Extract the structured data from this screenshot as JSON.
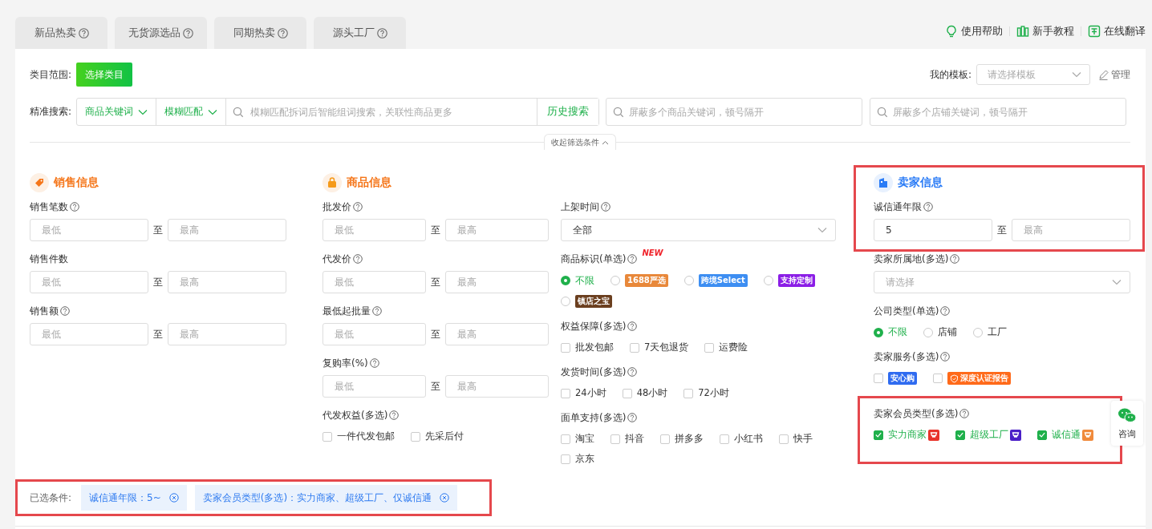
{
  "tabs": [
    {
      "label": "新品热卖",
      "selected": false
    },
    {
      "label": "无货源选品",
      "selected": false
    },
    {
      "label": "同期热卖",
      "selected": false
    },
    {
      "label": "源头工厂",
      "selected": false
    }
  ],
  "help_links": [
    "使用帮助",
    "新手教程",
    "在线翻译"
  ],
  "category": {
    "label": "类目范围:",
    "button": "选择类目"
  },
  "template": {
    "label": "我的模板:",
    "placeholder": "请选择模板",
    "manage": "管理"
  },
  "search": {
    "label": "精准搜索:",
    "dropdowns": [
      "商品关键词",
      "模糊匹配"
    ],
    "placeholder": "模糊匹配拆词后智能组词搜索，关联性商品更多",
    "history": "历史搜索",
    "exclude_placeholders": [
      "屏蔽多个商品关键词，顿号隔开",
      "屏蔽多个店铺关键词，顿号隔开"
    ]
  },
  "collapse": "收起筛选条件",
  "columns": [
    {
      "header": {
        "title": "销售信息",
        "color": "#f5761a",
        "highlighted": false
      },
      "fields": [
        {
          "kind": "range",
          "label": "销售笔数",
          "help": true,
          "min_placeholder": "最低",
          "separator": "至",
          "max_placeholder": "最高",
          "highlighted": false
        },
        {
          "kind": "range",
          "label": "销售件数",
          "help": false,
          "min_placeholder": "最低",
          "separator": "至",
          "max_placeholder": "最高",
          "highlighted": false
        },
        {
          "kind": "range",
          "label": "销售额",
          "help": true,
          "min_placeholder": "最低",
          "separator": "至",
          "max_placeholder": "最高",
          "highlighted": false
        }
      ]
    },
    {
      "header": {
        "title": "商品信息",
        "color": "#f5761a",
        "highlighted": false
      },
      "fields": [
        {
          "kind": "range",
          "label": "批发价",
          "help": true,
          "min_placeholder": "最低",
          "separator": "至",
          "max_placeholder": "最高",
          "highlighted": false
        },
        {
          "kind": "range",
          "label": "代发价",
          "help": true,
          "min_placeholder": "最低",
          "separator": "至",
          "max_placeholder": "最高",
          "highlighted": false
        },
        {
          "kind": "range",
          "label": "最低起批量",
          "help": true,
          "min_placeholder": "最低",
          "separator": "至",
          "max_placeholder": "最高",
          "highlighted": false
        },
        {
          "kind": "range",
          "label": "复购率(%)",
          "help": true,
          "min_placeholder": "最低",
          "separator": "至",
          "max_placeholder": "最高",
          "highlighted": false
        },
        {
          "kind": "checkbox",
          "label": "代发权益(多选)",
          "help": true,
          "highlighted": false,
          "options": [
            {
              "kind": "text",
              "label": "一件代发包邮",
              "checked": false
            },
            {
              "kind": "text",
              "label": "先采后付",
              "checked": false
            }
          ]
        }
      ]
    },
    {
      "fields": [
        {
          "kind": "select",
          "label": "上架时间",
          "help": true,
          "value": "全部",
          "highlighted": false
        },
        {
          "kind": "radio",
          "label": "商品标识(单选)",
          "help": true,
          "new_badge": "NEW",
          "highlighted": false,
          "options": [
            {
              "kind": "text",
              "label": "不限",
              "selected": true
            },
            {
              "kind": "tag",
              "label": "1688严选",
              "selected": false,
              "color": "#e8883a"
            },
            {
              "kind": "tag",
              "label": "跨境Select",
              "selected": false,
              "color": "#3d8ef2"
            },
            {
              "kind": "tag",
              "label": "支持定制",
              "selected": false,
              "color": "#8b1ee6"
            },
            {
              "kind": "tag",
              "label": "镇店之宝",
              "selected": false,
              "color": "#6b3f1f"
            }
          ]
        },
        {
          "kind": "checkbox",
          "label": "权益保障(多选)",
          "help": true,
          "highlighted": false,
          "options": [
            {
              "kind": "text",
              "label": "批发包邮",
              "checked": false
            },
            {
              "kind": "text",
              "label": "7天包退货",
              "checked": false
            },
            {
              "kind": "text",
              "label": "运费险",
              "checked": false
            }
          ]
        },
        {
          "kind": "checkbox",
          "label": "发货时间(多选)",
          "help": true,
          "highlighted": false,
          "options": [
            {
              "kind": "text",
              "label": "24小时",
              "checked": false
            },
            {
              "kind": "text",
              "label": "48小时",
              "checked": false
            },
            {
              "kind": "text",
              "label": "72小时",
              "checked": false
            }
          ]
        },
        {
          "kind": "checkbox",
          "label": "面单支持(多选)",
          "help": true,
          "highlighted": false,
          "options": [
            {
              "kind": "text",
              "label": "淘宝",
              "checked": false
            },
            {
              "kind": "text",
              "label": "抖音",
              "checked": false
            },
            {
              "kind": "text",
              "label": "拼多多",
              "checked": false
            },
            {
              "kind": "text",
              "label": "小红书",
              "checked": false
            },
            {
              "kind": "text",
              "label": "快手",
              "checked": false
            },
            {
              "kind": "text",
              "label": "京东",
              "checked": false
            }
          ]
        }
      ]
    },
    {
      "header": {
        "title": "卖家信息",
        "color": "#2b7cf6",
        "highlighted": true
      },
      "fields": [
        {
          "kind": "range",
          "label": "诚信通年限",
          "help": true,
          "min_value": "5",
          "separator": "至",
          "max_placeholder": "最高",
          "highlighted": true
        },
        {
          "kind": "select",
          "label": "卖家所属地(多选)",
          "help": true,
          "placeholder": "请选择",
          "highlighted": false
        },
        {
          "kind": "radio",
          "label": "公司类型(单选)",
          "help": true,
          "highlighted": false,
          "options": [
            {
              "kind": "text",
              "label": "不限",
              "selected": true
            },
            {
              "kind": "text",
              "label": "店铺",
              "selected": false
            },
            {
              "kind": "text",
              "label": "工厂",
              "selected": false
            }
          ]
        },
        {
          "kind": "checkbox",
          "label": "卖家服务(多选)",
          "help": true,
          "highlighted": false,
          "options": [
            {
              "kind": "tag",
              "label": "安心购",
              "checked": false,
              "color": "#2f6bf0"
            },
            {
              "kind": "shield_tag",
              "label": "深度认证报告",
              "checked": false,
              "color": "#ff6a1a"
            }
          ]
        },
        {
          "kind": "checkbox",
          "label": "卖家会员类型(多选)",
          "help": true,
          "highlighted": true,
          "options": [
            {
              "kind": "badge",
              "label": "实力商家",
              "checked": true,
              "color": "#e8332a"
            },
            {
              "kind": "badge",
              "label": "超级工厂",
              "checked": true,
              "color": "#4a1fc7"
            },
            {
              "kind": "badge",
              "label": "诚信通",
              "checked": true,
              "color": "#f08a3c"
            }
          ]
        }
      ]
    }
  ],
  "selected_conditions": {
    "label": "已选条件:",
    "highlighted": true,
    "tags": [
      "诚信通年限：5~",
      "卖家会员类型(多选)：实力商家、超级工厂、仅诚信通"
    ]
  },
  "consult": "咨询"
}
